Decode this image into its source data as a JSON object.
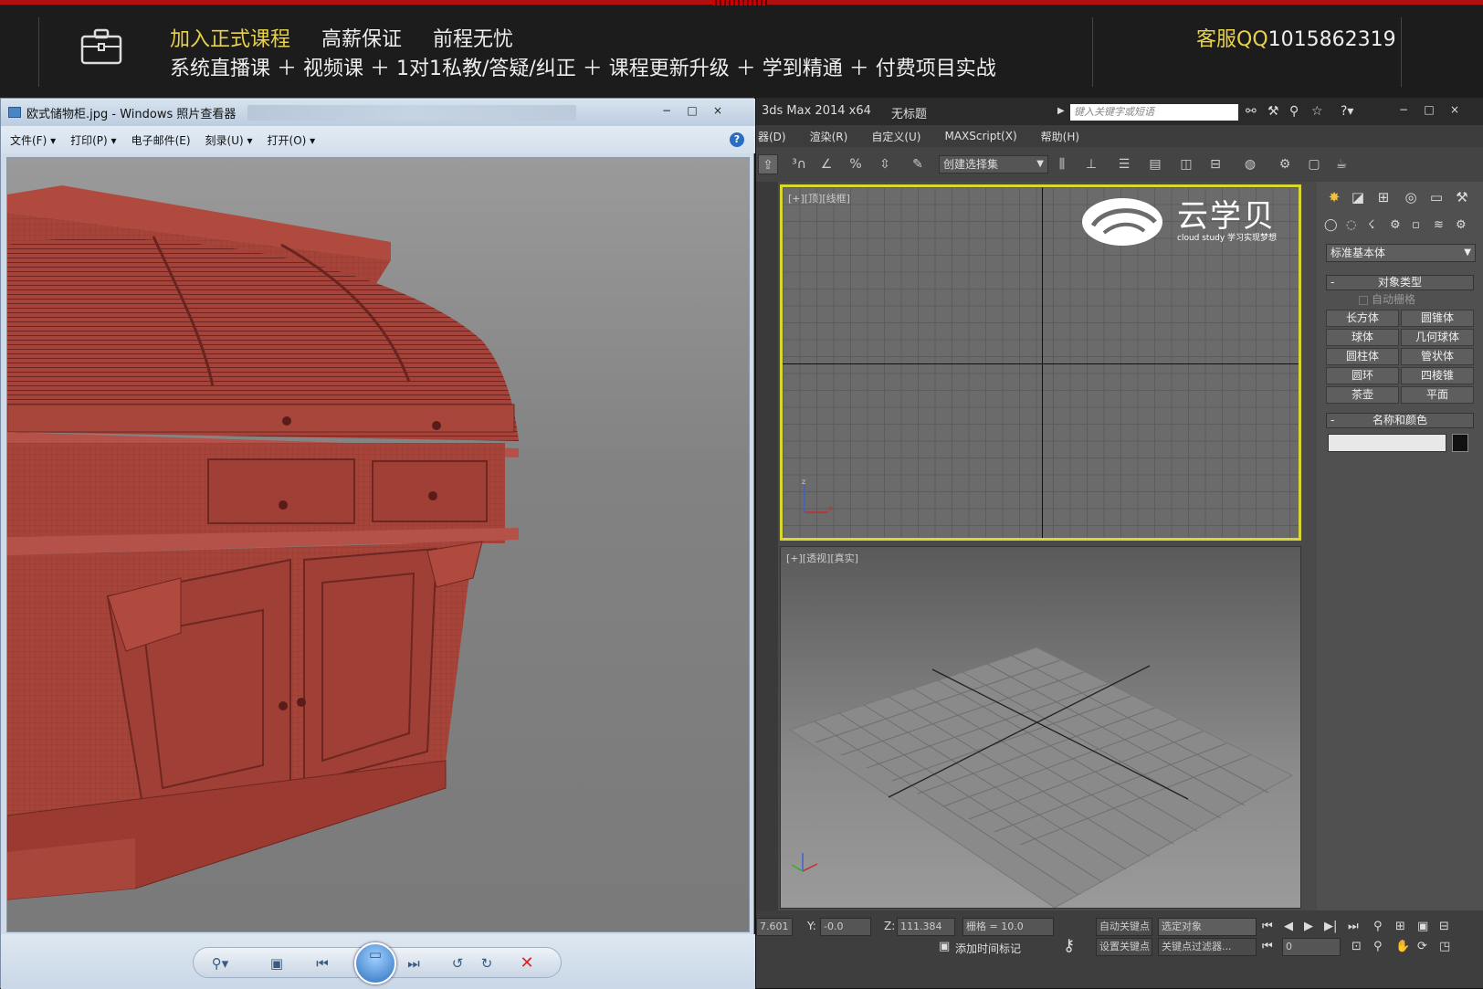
{
  "banner": {
    "line1": [
      "加入正式课程",
      "高薪保证",
      "前程无忧"
    ],
    "line2": "系统直播课 ＋ 视频课 ＋ 1对1私教/答疑/纠正 ＋ 课程更新升级 ＋ 学到精通 ＋ 付费项目实战",
    "qq_label": "客服QQ",
    "qq_number": "1015862319",
    "accent_color": "#e8d24a"
  },
  "photo_viewer": {
    "title": "欧式储物柜.jpg - Windows 照片查看器",
    "window_buttons": [
      "−",
      "□",
      "×"
    ],
    "menu": [
      "文件(F) ▾",
      "打印(P) ▾",
      "电子邮件(E)",
      "刻录(U) ▾",
      "打开(O) ▾"
    ],
    "help": "?",
    "controls": {
      "zoom": "⚲▾",
      "fit": "▣",
      "prev": "⏮",
      "slideshow": "▭",
      "next": "⏭",
      "rotate_ccw": "↺",
      "rotate_cw": "↻",
      "delete": "✕"
    },
    "model_color": "#a8453a"
  },
  "max": {
    "app_title": "3ds Max  2014 x64",
    "doc_title": "无标题",
    "search_placeholder": "键入关键字或短语",
    "window_buttons": [
      "−",
      "□",
      "×"
    ],
    "menu": [
      "器(D)",
      "渲染(R)",
      "自定义(U)",
      "MAXScript(X)",
      "帮助(H)"
    ],
    "selection_set": "创建选择集",
    "viewport_top_label": "[+][顶][线框]",
    "viewport_persp_label": "[+][透视][真实]",
    "logo_cn": "云学贝",
    "logo_en": "cloud study  学习实现梦想",
    "command_panel": {
      "dropdown": "标准基本体",
      "rollout_type": "对象类型",
      "autogrid": "自动栅格",
      "buttons": [
        "长方体",
        "圆锥体",
        "球体",
        "几何球体",
        "圆柱体",
        "管状体",
        "圆环",
        "四棱锥",
        "茶壶",
        "平面"
      ],
      "rollout_name": "名称和颜色"
    },
    "status": {
      "x_value": "7.601",
      "y_label": "Y:",
      "y_value": "-0.0",
      "z_label": "Z:",
      "z_value": "111.384",
      "grid": "栅格 = 10.0",
      "autokey": "自动关键点",
      "selected": "选定对象",
      "setkey": "设置关键点",
      "key_filter": "关键点过滤器...",
      "add_time_tag": "添加时间标记",
      "frame": "0"
    }
  }
}
